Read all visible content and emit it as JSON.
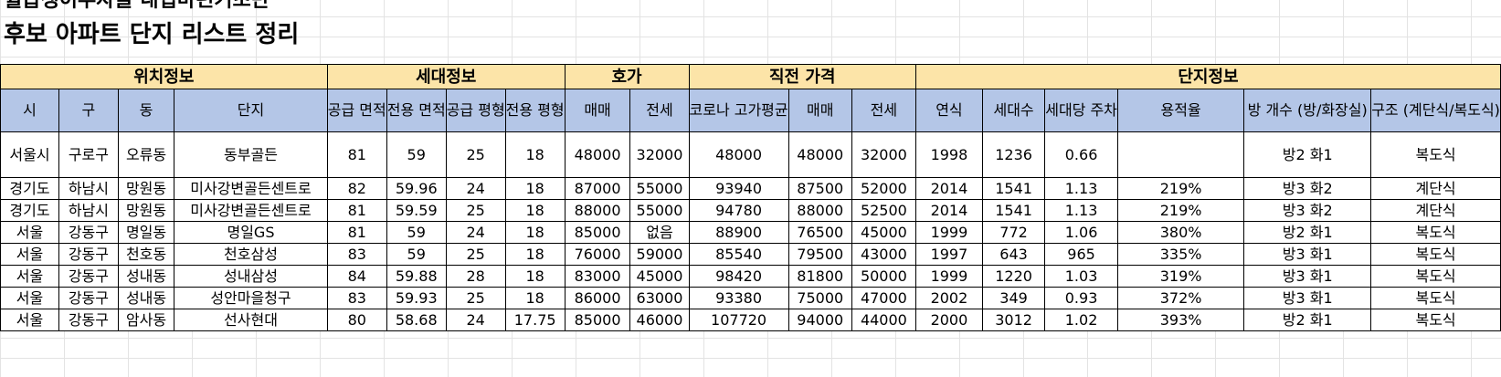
{
  "title_line1": "월급쟁이부자들 내집마련기초반",
  "title_line2": "후보 아파트 단지 리스트 정리",
  "groups": {
    "location": "위치정보",
    "unit": "세대정보",
    "asking": "호가",
    "recent": "직전 가격",
    "complex": "단지정보"
  },
  "columns": [
    "시",
    "구",
    "동",
    "단지",
    "공급 면적",
    "전용 면적",
    "공급 평형",
    "전용 평형",
    "매매",
    "전세",
    "코로나 고가평균",
    "매매",
    "전세",
    "연식",
    "세대수",
    "세대당 주차",
    "용적율",
    "방 개수 (방/화장실)",
    "구조 (계단식/복도식)"
  ],
  "rows": [
    [
      "서울시",
      "구로구",
      "오류동",
      "동부골든",
      "81",
      "59",
      "25",
      "18",
      "48000",
      "32000",
      "48000",
      "48000",
      "32000",
      "1998",
      "1236",
      "0.66",
      "",
      "방2 화1",
      "복도식"
    ],
    [
      "경기도",
      "하남시",
      "망원동",
      "미사강변골든센트로",
      "82",
      "59.96",
      "24",
      "18",
      "87000",
      "55000",
      "93940",
      "87500",
      "52000",
      "2014",
      "1541",
      "1.13",
      "219%",
      "방3 화2",
      "계단식"
    ],
    [
      "경기도",
      "하남시",
      "망원동",
      "미사강변골든센트로",
      "81",
      "59.59",
      "25",
      "18",
      "88000",
      "55000",
      "94780",
      "88000",
      "52500",
      "2014",
      "1541",
      "1.13",
      "219%",
      "방3 화2",
      "계단식"
    ],
    [
      "서울",
      "강동구",
      "명일동",
      "명일GS",
      "81",
      "59",
      "24",
      "18",
      "85000",
      "없음",
      "88900",
      "76500",
      "45000",
      "1999",
      "772",
      "1.06",
      "380%",
      "방2 화1",
      "복도식"
    ],
    [
      "서울",
      "강동구",
      "천호동",
      "천호삼성",
      "83",
      "59",
      "25",
      "18",
      "76000",
      "59000",
      "85540",
      "79500",
      "43000",
      "1997",
      "643",
      "965",
      "335%",
      "방3 화1",
      "복도식"
    ],
    [
      "서울",
      "강동구",
      "성내동",
      "성내삼성",
      "84",
      "59.88",
      "28",
      "18",
      "83000",
      "45000",
      "98420",
      "81800",
      "50000",
      "1999",
      "1220",
      "1.03",
      "319%",
      "방3 화1",
      "복도식"
    ],
    [
      "서울",
      "강동구",
      "성내동",
      "성안마을청구",
      "83",
      "59.93",
      "25",
      "18",
      "86000",
      "63000",
      "93380",
      "75000",
      "47000",
      "2002",
      "349",
      "0.93",
      "372%",
      "방3 화1",
      "복도식"
    ],
    [
      "서울",
      "강동구",
      "암사동",
      "선사현대",
      "80",
      "58.68",
      "24",
      "17.75",
      "85000",
      "46000",
      "107720",
      "94000",
      "44000",
      "2000",
      "3012",
      "1.02",
      "393%",
      "방2 화1",
      "복도식"
    ]
  ]
}
